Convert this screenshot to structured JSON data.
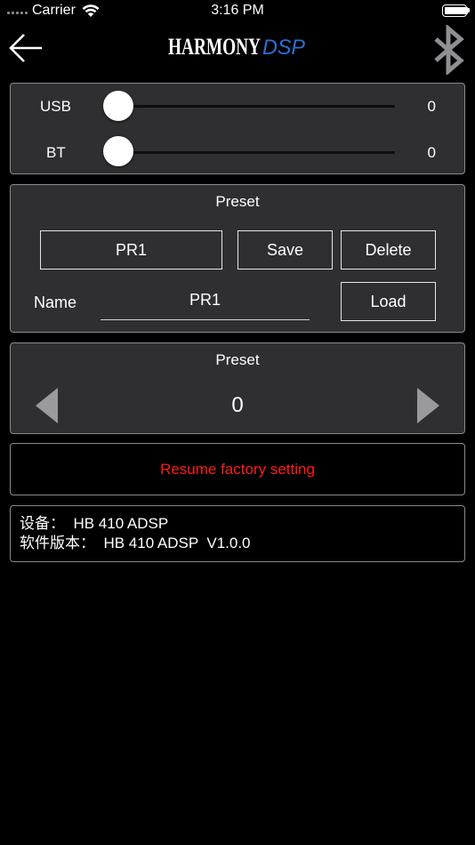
{
  "status_bar": {
    "carrier": "Carrier",
    "time": "3:16 PM",
    "battery_level": 1.0
  },
  "nav": {
    "back_icon": "back-arrow-icon",
    "logo_text": "HARMONY",
    "logo_accent": "DSP",
    "logo_accent_color": "#2e6fd6",
    "bluetooth_icon": "bluetooth-icon"
  },
  "volume": {
    "usb_label": "USB",
    "usb_value": "0",
    "usb_level": 0,
    "bt_label": "BT",
    "bt_value": "0",
    "bt_level": 0
  },
  "preset_editor": {
    "title": "Preset",
    "preset_button": "PR1",
    "save_label": "Save",
    "delete_label": "Delete",
    "name_label": "Name",
    "name_value": "PR1",
    "load_label": "Load"
  },
  "preset_selector": {
    "title": "Preset",
    "value": "0",
    "prev_icon": "triangle-left-icon",
    "next_icon": "triangle-right-icon"
  },
  "factory": {
    "label": "Resume factory setting",
    "color": "#ff1a1a"
  },
  "device_info": {
    "device_line": "设备：  HB 410 ADSP",
    "version_line": "软件版本：  HB 410 ADSP  V1.0.0"
  }
}
